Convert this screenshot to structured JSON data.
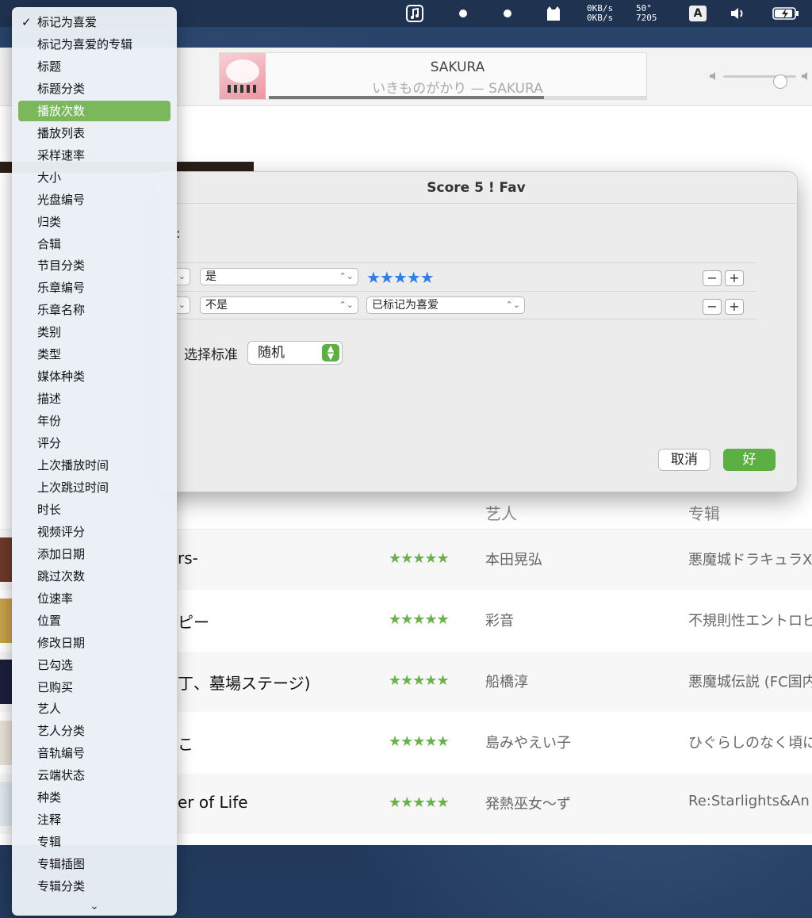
{
  "menubar": {
    "net_up": "0KB/s",
    "net_down": "0KB/s",
    "temp": "50°",
    "fan": "7205",
    "input_method": "A"
  },
  "player": {
    "title": "SAKURA",
    "subtitle": "いきものがかり — SAKURA",
    "progress": 0.73,
    "volume": 0.78
  },
  "dialog": {
    "title": "Score 5 ! Fav",
    "colon": ":",
    "rules": [
      {
        "operator": "是",
        "value_stars": "★★★★★"
      },
      {
        "operator": "不是",
        "value": "已标记为喜爱"
      }
    ],
    "select_label": "选择标准",
    "select_value": "随机",
    "cancel": "取消",
    "ok": "好"
  },
  "list": {
    "header_artist": "艺人",
    "header_album": "专辑",
    "rows": [
      {
        "name": "rs-",
        "stars": "★★★★★",
        "artist": "本田晃弘",
        "album": "悪魔城ドラキュラX"
      },
      {
        "name": "ピー",
        "stars": "★★★★★",
        "artist": "彩音",
        "album": "不規則性エントロピ"
      },
      {
        "name": "丁、墓場ステージ)",
        "stars": "★★★★★",
        "artist": "船橋淳",
        "album": "悪魔城伝説 (FC国内"
      },
      {
        "name": "こ",
        "stars": "★★★★★",
        "artist": "島みやえい子",
        "album": "ひぐらしのなく頃に"
      },
      {
        "name": "er of Life",
        "stars": "★★★★★",
        "artist": "発熱巫女～ず",
        "album": "Re:Starlights&An U"
      }
    ]
  },
  "menu": {
    "checkmark": "✓",
    "items": [
      "标记为喜爱",
      "标记为喜爱的专辑",
      "标题",
      "标题分类",
      "播放次数",
      "播放列表",
      "采样速率",
      "大小",
      "光盘编号",
      "归类",
      "合辑",
      "节目分类",
      "乐章编号",
      "乐章名称",
      "类别",
      "类型",
      "媒体种类",
      "描述",
      "年份",
      "评分",
      "上次播放时间",
      "上次跳过时间",
      "时长",
      "视频评分",
      "添加日期",
      "跳过次数",
      "位速率",
      "位置",
      "修改日期",
      "已勾选",
      "已购买",
      "艺人",
      "艺人分类",
      "音轨编号",
      "云端状态",
      "种类",
      "注释",
      "专辑",
      "专辑插图",
      "专辑分类"
    ],
    "checked_index": 0,
    "selected_index": 4,
    "scroll_arrow": "⌄"
  },
  "colors": {
    "accent_green": "#5cb043",
    "star_blue": "#2f7ee8",
    "star_green": "#6ab04c"
  }
}
